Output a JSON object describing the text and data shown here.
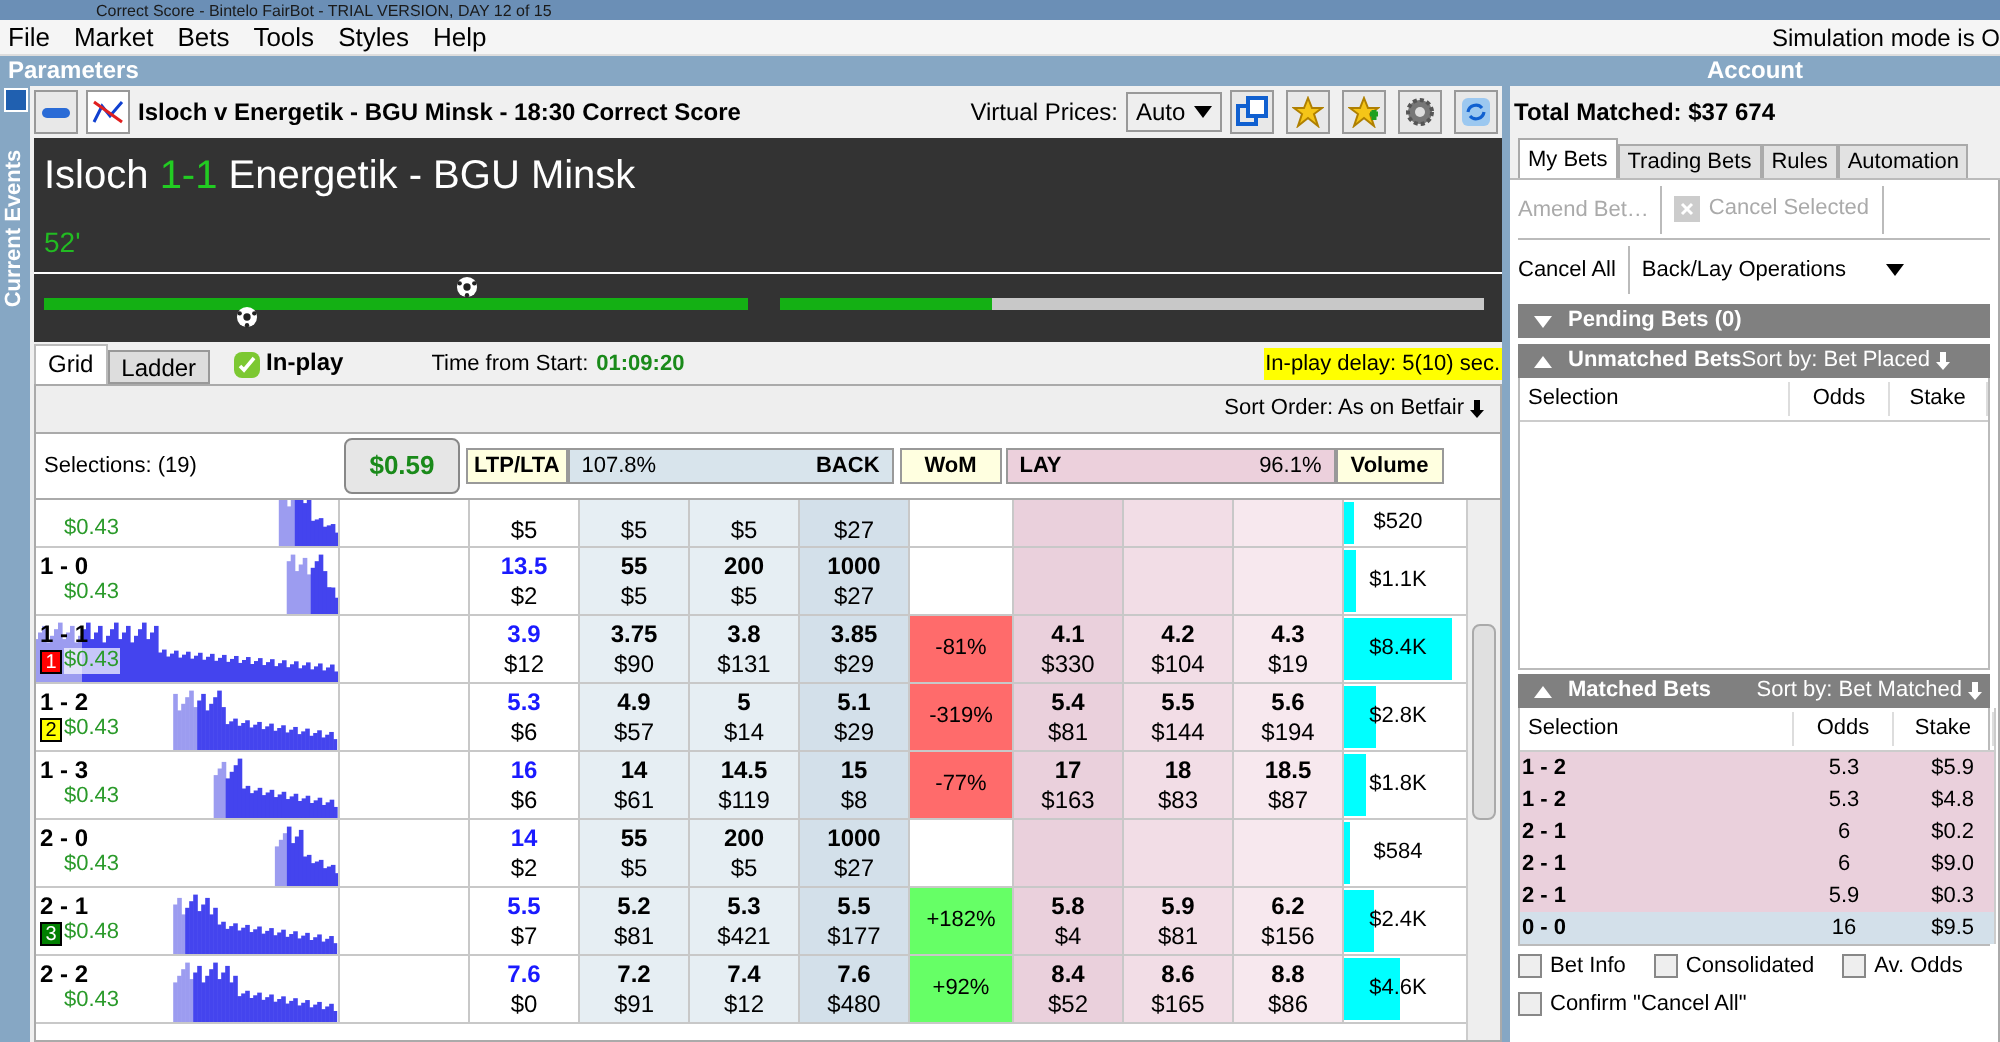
{
  "window": {
    "title": "Correct Score - Bintelo FairBot - TRIAL VERSION, DAY 12 of 15"
  },
  "menu": [
    "File",
    "Market",
    "Bets",
    "Tools",
    "Styles",
    "Help"
  ],
  "simulation_notice": "Simulation mode is O",
  "left_header": "Parameters",
  "side_tab": "Current Events",
  "market": {
    "title": "Isloch v Energetik - BGU Minsk - 18:30 Correct Score",
    "virtual_prices_label": "Virtual Prices:",
    "virtual_prices_value": "Auto"
  },
  "match": {
    "home": "Isloch",
    "score": "1-1",
    "away": "Energetik - BGU Minsk",
    "minute": "52'",
    "bars": [
      {
        "level": 1
      },
      {
        "level": 0.3
      }
    ]
  },
  "tabs": [
    {
      "label": "Grid",
      "selected": true
    },
    {
      "label": "Ladder",
      "selected": false
    }
  ],
  "inplay": {
    "label": "In-play",
    "checked": true
  },
  "time_label": "Time from Start:",
  "time_value": "01:09:20",
  "delay": "In-play delay: 5(10) sec.",
  "sort_order": "Sort Order: As on Betfair",
  "grid_header": {
    "selections": "Selections: (19)",
    "total": "$0.59",
    "ltp": "LTP/LTA",
    "back_pct": "107.8%",
    "back": "BACK",
    "wom": "WoM",
    "lay": "LAY",
    "lay_pct": "96.1%",
    "volume": "Volume"
  },
  "rows": [
    {
      "money": "$0.43",
      "ltp_amt": "$5",
      "back": [
        {
          "amount": "$5"
        },
        {
          "amount": "$5"
        },
        {
          "amount": "$27"
        }
      ],
      "lay": [],
      "volume": "$520",
      "level": 0.1
    },
    {
      "name": "1 - 0",
      "money": "$0.43",
      "ltp": "13.5",
      "ltp_amt": "$2",
      "back": [
        {
          "odds": "55",
          "amount": "$5"
        },
        {
          "odds": "200",
          "amount": "$5"
        },
        {
          "odds": "1000",
          "amount": "$27"
        }
      ],
      "lay": [],
      "volume": "$1.1K",
      "level": 0.12
    },
    {
      "name": "1 - 1",
      "money": "$0.43",
      "badge": {
        "text": "1",
        "color": "#ff0000"
      },
      "ltp": "3.9",
      "ltp_amt": "$12",
      "back": [
        {
          "odds": "3.75",
          "amount": "$90"
        },
        {
          "odds": "3.8",
          "amount": "$131"
        },
        {
          "odds": "3.85",
          "amount": "$29"
        }
      ],
      "wom": {
        "text": "-81%",
        "color": "#ff6b6b"
      },
      "lay": [
        {
          "odds": "4.1",
          "amount": "$330"
        },
        {
          "odds": "4.2",
          "amount": "$104"
        },
        {
          "odds": "4.3",
          "amount": "$19"
        }
      ],
      "volume": "$8.4K",
      "level": 1
    },
    {
      "name": "1 - 2",
      "money": "$0.43",
      "badge": {
        "text": "2",
        "color": "#ffff00"
      },
      "ltp": "5.3",
      "ltp_amt": "$6",
      "back": [
        {
          "odds": "4.9",
          "amount": "$57"
        },
        {
          "odds": "5",
          "amount": "$14"
        },
        {
          "odds": "5.1",
          "amount": "$29"
        }
      ],
      "wom": {
        "text": "-319%",
        "color": "#ff6b6b"
      },
      "lay": [
        {
          "odds": "5.4",
          "amount": "$81"
        },
        {
          "odds": "5.5",
          "amount": "$144"
        },
        {
          "odds": "5.6",
          "amount": "$194"
        }
      ],
      "volume": "$2.8K",
      "level": 0.3
    },
    {
      "name": "1 - 3",
      "money": "$0.43",
      "ltp": "16",
      "ltp_amt": "$6",
      "back": [
        {
          "odds": "14",
          "amount": "$61"
        },
        {
          "odds": "14.5",
          "amount": "$119"
        },
        {
          "odds": "15",
          "amount": "$8"
        }
      ],
      "wom": {
        "text": "-77%",
        "color": "#ff6b6b"
      },
      "lay": [
        {
          "odds": "17",
          "amount": "$163"
        },
        {
          "odds": "18",
          "amount": "$83"
        },
        {
          "odds": "18.5",
          "amount": "$87"
        }
      ],
      "volume": "$1.8K",
      "level": 0.2
    },
    {
      "name": "2 - 0",
      "money": "$0.43",
      "ltp": "14",
      "ltp_amt": "$2",
      "back": [
        {
          "odds": "55",
          "amount": "$5"
        },
        {
          "odds": "200",
          "amount": "$5"
        },
        {
          "odds": "1000",
          "amount": "$27"
        }
      ],
      "lay": [],
      "volume": "$584",
      "level": 0.06
    },
    {
      "name": "2 - 1",
      "money": "$0.48",
      "badge": {
        "text": "3",
        "color": "#008000"
      },
      "ltp": "5.5",
      "ltp_amt": "$7",
      "back": [
        {
          "odds": "5.2",
          "amount": "$81"
        },
        {
          "odds": "5.3",
          "amount": "$421"
        },
        {
          "odds": "5.5",
          "amount": "$177"
        }
      ],
      "wom": {
        "text": "+182%",
        "color": "#66ff66"
      },
      "lay": [
        {
          "odds": "5.8",
          "amount": "$4"
        },
        {
          "odds": "5.9",
          "amount": "$81"
        },
        {
          "odds": "6.2",
          "amount": "$156"
        }
      ],
      "volume": "$2.4K",
      "level": 0.27
    },
    {
      "name": "2 - 2",
      "money": "$0.43",
      "ltp": "7.6",
      "ltp_amt": "$0",
      "back": [
        {
          "odds": "7.2",
          "amount": "$91"
        },
        {
          "odds": "7.4",
          "amount": "$12"
        },
        {
          "odds": "7.6",
          "amount": "$480"
        }
      ],
      "wom": {
        "text": "+92%",
        "color": "#66ff66"
      },
      "lay": [
        {
          "odds": "8.4",
          "amount": "$52"
        },
        {
          "odds": "8.6",
          "amount": "$165"
        },
        {
          "odds": "8.8",
          "amount": "$86"
        }
      ],
      "volume": "$4.6K",
      "level": 0.52
    }
  ],
  "account": {
    "header": "Account",
    "total_matched": "Total Matched: $37 674",
    "tabs": [
      {
        "label": "My Bets",
        "selected": true
      },
      {
        "label": "Trading Bets",
        "selected": false
      },
      {
        "label": "Rules",
        "selected": false
      },
      {
        "label": "Automation",
        "selected": false
      }
    ],
    "amend": {
      "label": "Amend Bet…",
      "disabled": true
    },
    "cancel_selected": {
      "label": "Cancel Selected",
      "disabled": true
    },
    "cancel_all": "Cancel All",
    "backlay": "Back/Lay Operations",
    "pending": {
      "title": "Pending Bets (0)",
      "expanded": false
    },
    "unmatched": {
      "title": "Unmatched Bets",
      "sort": "Sort by: Bet Placed",
      "expanded": true,
      "columns": [
        "Selection",
        "Odds",
        "Stake"
      ]
    },
    "matched": {
      "title": "Matched Bets",
      "sort": "Sort by: Bet Matched",
      "expanded": true,
      "columns": [
        "Selection",
        "Odds",
        "Stake"
      ],
      "rows": [
        {
          "selection": "1 - 2",
          "odds": "5.3",
          "stake": "$5.9",
          "is_lay": true
        },
        {
          "selection": "1 - 2",
          "odds": "5.3",
          "stake": "$4.8",
          "is_lay": true
        },
        {
          "selection": "2 - 1",
          "odds": "6",
          "stake": "$0.2",
          "is_lay": true
        },
        {
          "selection": "2 - 1",
          "odds": "6",
          "stake": "$9.0",
          "is_lay": true
        },
        {
          "selection": "2 - 1",
          "odds": "5.9",
          "stake": "$0.3",
          "is_lay": true
        },
        {
          "selection": "0 - 0",
          "odds": "16",
          "stake": "$9.5",
          "is_lay": false
        }
      ]
    },
    "options": [
      {
        "label": "Bet Info",
        "checked": false
      },
      {
        "label": "Consolidated",
        "checked": false
      },
      {
        "label": "Av. Odds",
        "checked": false
      },
      {
        "label": "Confirm \"Cancel All\"",
        "checked": false
      }
    ]
  }
}
